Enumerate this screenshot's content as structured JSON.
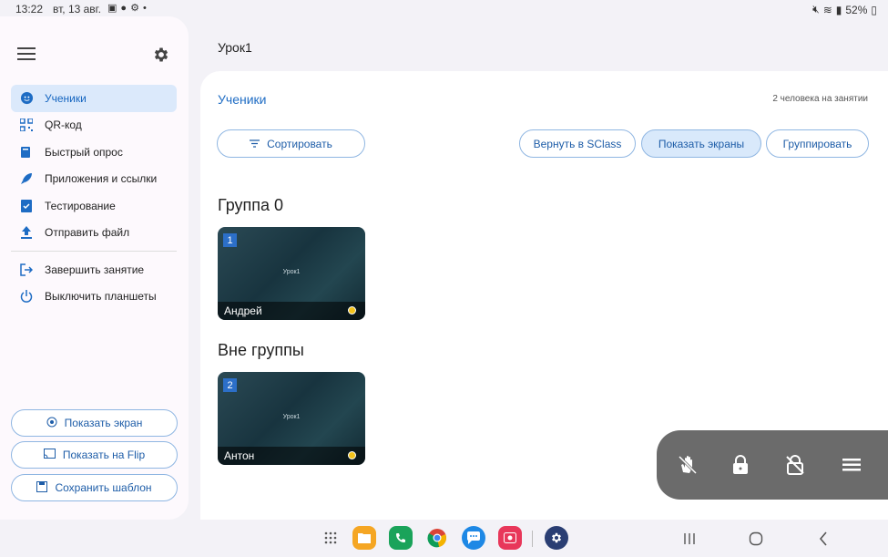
{
  "status_bar": {
    "time": "13:22",
    "date": "вт, 13 авг.",
    "battery": "52%"
  },
  "lesson_title": "Урок1",
  "sidebar": {
    "items": [
      {
        "label": "Ученики",
        "icon": "student-face-icon"
      },
      {
        "label": "QR-код",
        "icon": "qr-code-icon"
      },
      {
        "label": "Быстрый опрос",
        "icon": "quick-poll-icon"
      },
      {
        "label": "Приложения и ссылки",
        "icon": "rocket-icon"
      },
      {
        "label": "Тестирование",
        "icon": "test-document-icon"
      },
      {
        "label": "Отправить файл",
        "icon": "upload-icon"
      }
    ],
    "items2": [
      {
        "label": "Завершить занятие",
        "icon": "exit-icon"
      },
      {
        "label": "Выключить планшеты",
        "icon": "power-icon"
      }
    ],
    "buttons": {
      "show_screen": "Показать экран",
      "show_flip": "Показать на Flip",
      "save_template": "Сохранить шаблон"
    }
  },
  "main": {
    "title": "Ученики",
    "count": "2 человека на занятии",
    "sort": "Сортировать",
    "return": "Вернуть в SClass",
    "show_screens": "Показать экраны",
    "group_btn": "Группировать",
    "groups": [
      {
        "title": "Группа 0",
        "students": [
          {
            "num": "1",
            "name": "Андрей",
            "screen_title": "Урок1"
          }
        ]
      },
      {
        "title": "Вне группы",
        "students": [
          {
            "num": "2",
            "name": "Антон",
            "screen_title": "Урок1"
          }
        ]
      }
    ]
  },
  "colors": {
    "accent": "#1e6cc4",
    "status_dot": "#f2c21b",
    "panel": "#6b6b6b"
  }
}
